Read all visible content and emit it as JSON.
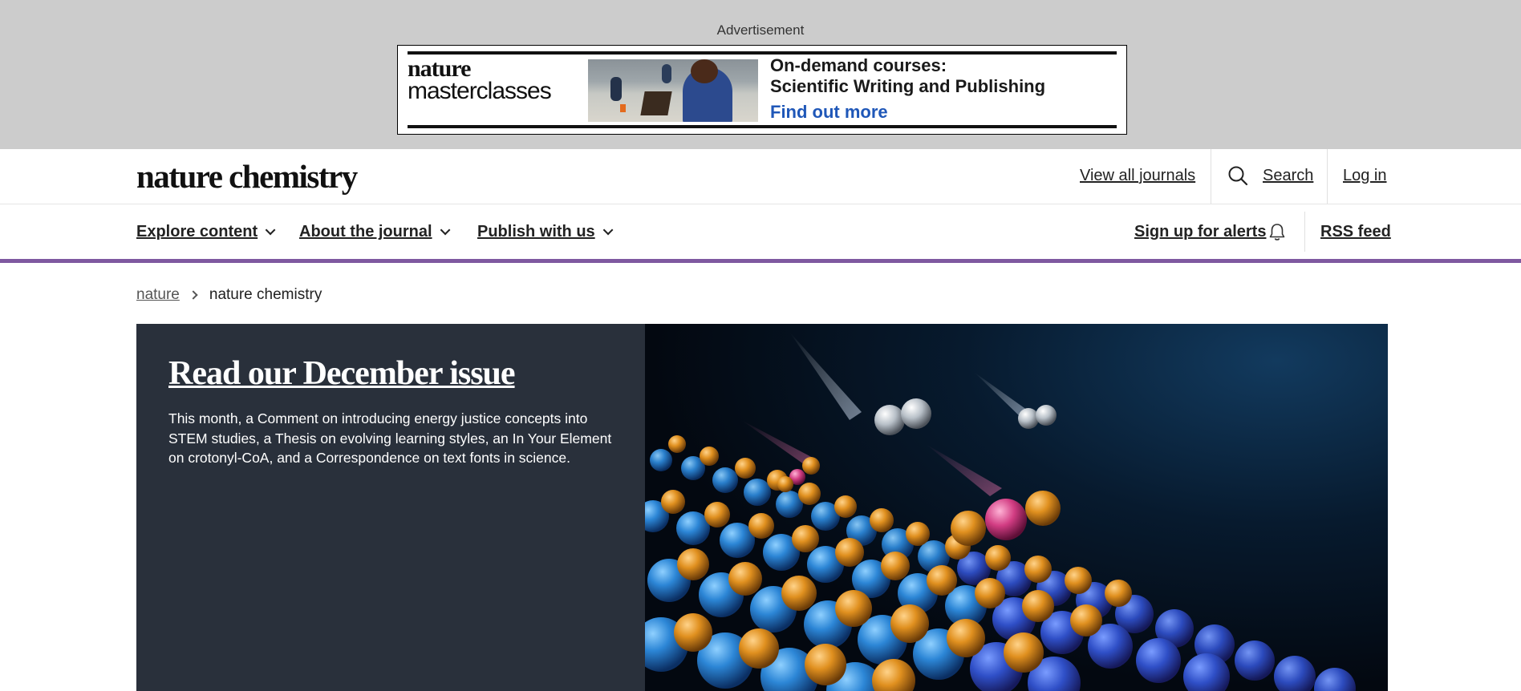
{
  "ad": {
    "label": "Advertisement",
    "logo_line1": "nature",
    "logo_line2": "masterclasses",
    "headline_line1": "On-demand courses:",
    "headline_line2": "Scientific Writing and Publishing",
    "cta": "Find out more",
    "cta_color": "#1f57b8"
  },
  "header": {
    "brand": "nature chemistry",
    "view_all_journals": "View all journals",
    "search_label": "Search",
    "search_icon": "search-icon",
    "login": "Log in"
  },
  "nav": {
    "items": [
      {
        "label": "Explore content",
        "icon": "chevron-down-icon"
      },
      {
        "label": "About the journal",
        "icon": "chevron-down-icon"
      },
      {
        "label": "Publish with us",
        "icon": "chevron-down-icon"
      }
    ],
    "alerts": "Sign up for alerts",
    "alerts_icon": "bell-icon",
    "rss": "RSS feed",
    "accent_color": "#7f59a0"
  },
  "breadcrumb": {
    "root": "nature",
    "current": "nature chemistry"
  },
  "hero": {
    "title": "Read our December issue",
    "description": "This month, a Comment on introducing energy justice concepts into STEM studies, a Thesis on evolving learning styles, an In Your Element on crotonyl-CoA, and a Correspondence on text fonts in science.",
    "panel_color": "#29303b"
  }
}
